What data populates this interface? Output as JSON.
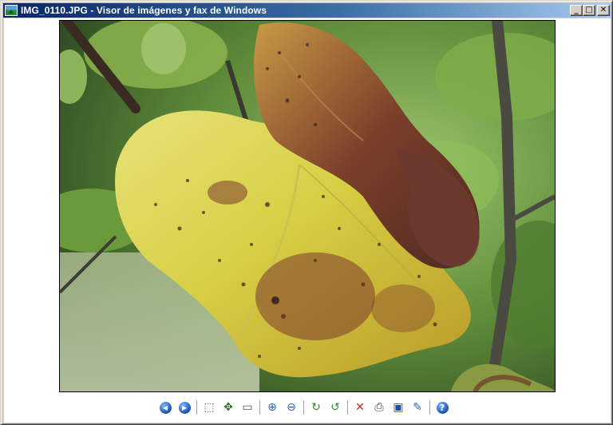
{
  "window": {
    "title": "IMG_0110.JPG - Visor de imágenes y fax de Windows",
    "caption_buttons": {
      "minimize": "_",
      "maximize": "□",
      "close": "✕"
    }
  },
  "image": {
    "filename": "IMG_0110.JPG"
  },
  "toolbar": {
    "buttons": [
      {
        "name": "previous-image",
        "icon": "arrow-left-circle-icon",
        "glyph": "◀"
      },
      {
        "name": "next-image",
        "icon": "arrow-right-circle-icon",
        "glyph": "▶"
      },
      {
        "name": "best-fit",
        "icon": "fit-icon",
        "glyph": "⬚"
      },
      {
        "name": "actual-size",
        "icon": "actual-size-icon",
        "glyph": "✥"
      },
      {
        "name": "slideshow",
        "icon": "slideshow-icon",
        "glyph": "▭"
      },
      {
        "name": "zoom-in",
        "icon": "zoom-in-icon",
        "glyph": "⊕"
      },
      {
        "name": "zoom-out",
        "icon": "zoom-out-icon",
        "glyph": "⊖"
      },
      {
        "name": "rotate-clockwise",
        "icon": "rotate-clockwise-icon",
        "glyph": "↻"
      },
      {
        "name": "rotate-counterclockwise",
        "icon": "rotate-counterclockwise-icon",
        "glyph": "↺"
      },
      {
        "name": "delete",
        "icon": "delete-icon",
        "glyph": "✕"
      },
      {
        "name": "print",
        "icon": "print-icon",
        "glyph": "⎙"
      },
      {
        "name": "save",
        "icon": "save-icon",
        "glyph": "▣"
      },
      {
        "name": "edit",
        "icon": "edit-image-icon",
        "glyph": "✎"
      },
      {
        "name": "help",
        "icon": "help-icon",
        "glyph": "?"
      }
    ]
  },
  "colors": {
    "titlebar_start": "#0a246a",
    "titlebar_end": "#a6caf0",
    "delete_red": "#c0281c",
    "rotate_green": "#2f8a2f"
  }
}
